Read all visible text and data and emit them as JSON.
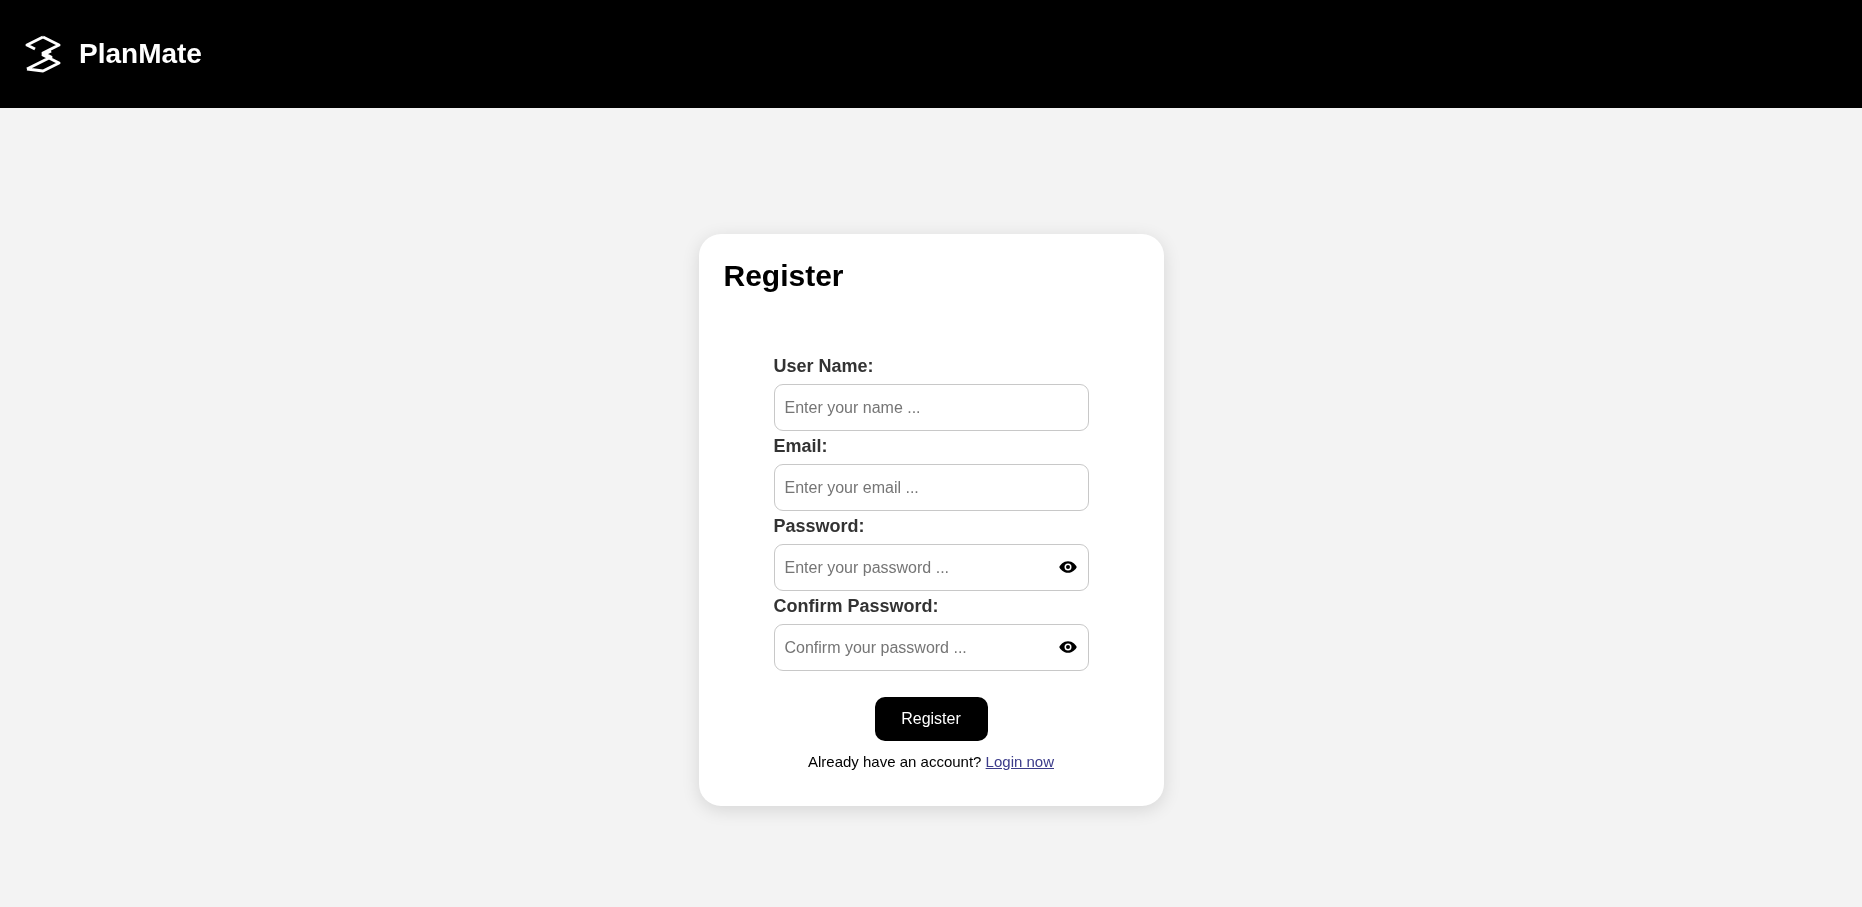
{
  "header": {
    "brand": "PlanMate"
  },
  "form": {
    "title": "Register",
    "fields": [
      {
        "kind": "text",
        "label": "User Name:",
        "placeholder": "Enter your name ..."
      },
      {
        "kind": "text",
        "label": "Email:",
        "placeholder": "Enter your email ..."
      },
      {
        "kind": "password",
        "label": "Password:",
        "placeholder": "Enter your password ..."
      },
      {
        "kind": "password",
        "label": "Confirm Password:",
        "placeholder": "Confirm your password ..."
      }
    ],
    "submit": "Register",
    "footer_text": "Already have an account?",
    "footer_link": "Login now"
  }
}
